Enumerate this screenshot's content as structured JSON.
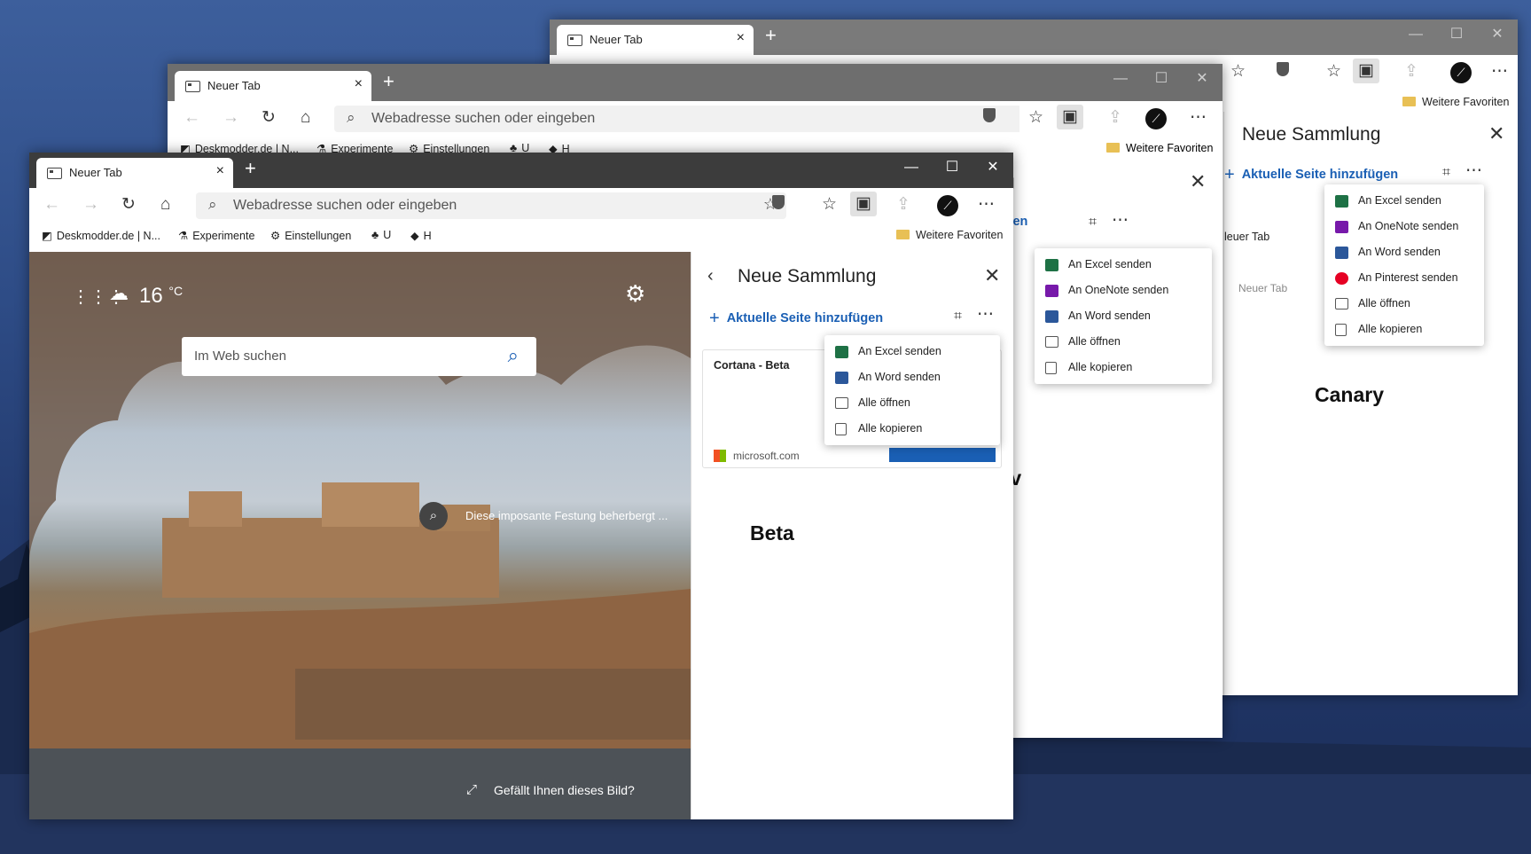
{
  "tab_title": "Neuer Tab",
  "window_controls": {
    "minimize": "—",
    "maximize": "☐",
    "close": "✕"
  },
  "address_placeholder": "Webadresse suchen oder eingeben",
  "favorites": {
    "deskmodder": "Deskmodder.de | N...",
    "experimente": "Experimente",
    "einstellungen": "Einstellungen",
    "u": "U",
    "h": "H",
    "weitere": "Weitere Favoriten"
  },
  "collection_title": "Neue Sammlung",
  "add_page": "Aktuelle Seite hinzufügen",
  "menu": {
    "excel": "An Excel senden",
    "onenote": "An OneNote senden",
    "word": "An Word senden",
    "pinterest": "An Pinterest senden",
    "open_all": "Alle öffnen",
    "copy_all": "Alle kopieren"
  },
  "beta": {
    "weather": "16",
    "weather_unit": "°C",
    "search_placeholder": "Im Web suchen",
    "caption": "Diese imposante Festung beherbergt ...",
    "like": "Gefällt Ihnen dieses Bild?",
    "card_title": "Cortana - Beta",
    "card_source": "microsoft.com",
    "label": "Beta"
  },
  "dev": {
    "label": "Dev",
    "title_partial": "mmlung",
    "add_partial": "e hinzufügen"
  },
  "canary": {
    "label": "Canary",
    "item_title": "leuer Tab",
    "item_sub": "Neuer Tab"
  }
}
